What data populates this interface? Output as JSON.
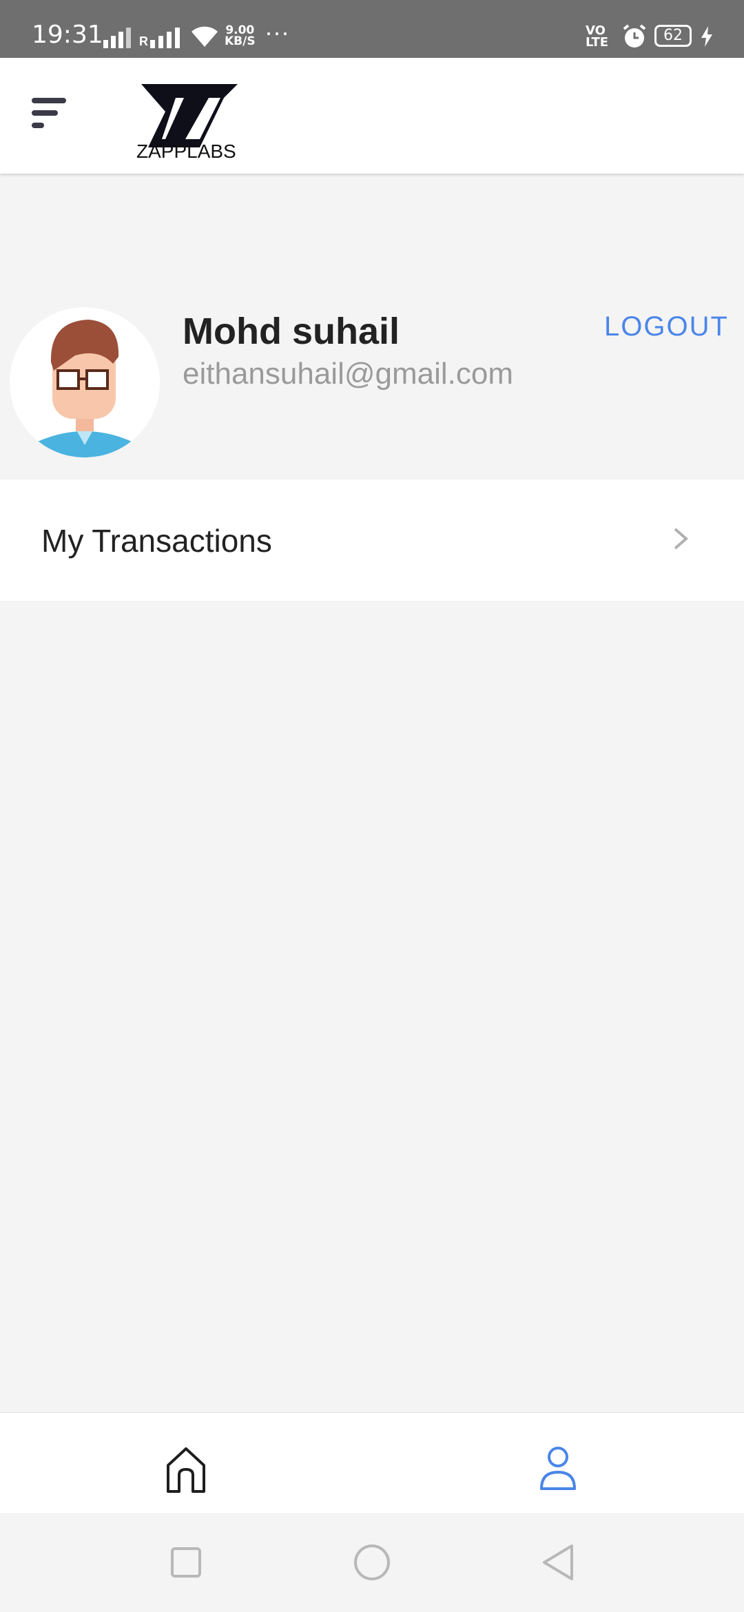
{
  "status_bar": {
    "time": "19:31",
    "net_speed_value": "9.00",
    "net_speed_unit": "KB/S",
    "more": "···",
    "volte_line1": "VO",
    "volte_line2": "LTE",
    "battery": "62",
    "roaming": "R"
  },
  "header": {
    "brand": "ZAPPLABS"
  },
  "profile": {
    "name": "Mohd suhail",
    "email": "eithansuhail@gmail.com",
    "logout_label": "LOGOUT"
  },
  "menu": {
    "transactions_label": "My Transactions"
  },
  "colors": {
    "accent": "#4a86e8",
    "status_bar": "#6f6f6f",
    "background": "#f4f4f4"
  },
  "icons": {
    "menu": "menu-icon",
    "home": "home-icon",
    "profile": "user-icon",
    "chevron": "chevron-right-icon"
  }
}
